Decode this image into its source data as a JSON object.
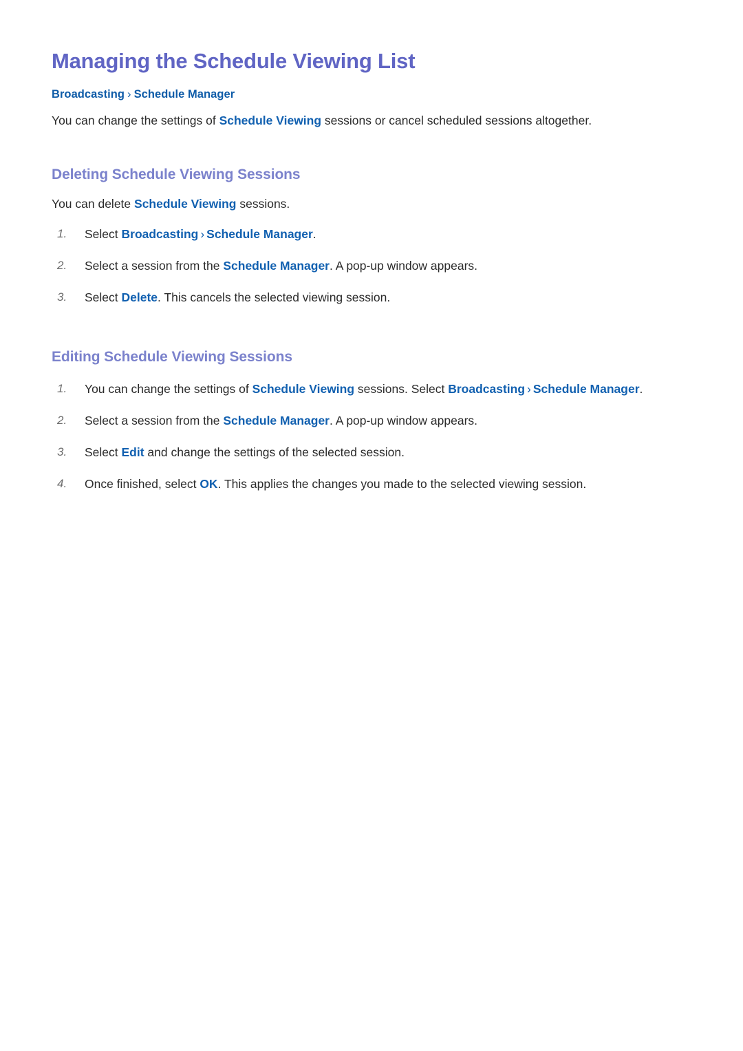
{
  "page": {
    "title": "Managing the Schedule Viewing List",
    "breadcrumb": {
      "first": "Broadcasting",
      "separator": "›",
      "second": "Schedule Manager"
    },
    "intro": {
      "before": "You can change the settings of ",
      "keyword": "Schedule Viewing",
      "after": " sessions or cancel scheduled sessions altogether."
    }
  },
  "sections": [
    {
      "heading": "Deleting Schedule Viewing Sessions",
      "lead": {
        "before": "You can delete ",
        "keyword": "Schedule Viewing",
        "after": " sessions."
      },
      "steps": [
        {
          "num": "1.",
          "p1": "Select ",
          "k1": "Broadcasting",
          "sep": "›",
          "k2": "Schedule Manager",
          "p2": "."
        },
        {
          "num": "2.",
          "p1": "Select a session from the ",
          "k1": "Schedule Manager",
          "p2": ". A pop-up window appears."
        },
        {
          "num": "3.",
          "p1": "Select ",
          "k1": "Delete",
          "p2": ". This cancels the selected viewing session."
        }
      ]
    },
    {
      "heading": "Editing Schedule Viewing Sessions",
      "steps": [
        {
          "num": "1.",
          "p1": "You can change the settings of ",
          "k1": "Schedule Viewing",
          "p2": " sessions. Select ",
          "k2": "Broadcasting",
          "sep": "›",
          "k3": "Schedule Manager",
          "p3": "."
        },
        {
          "num": "2.",
          "p1": "Select a session from the ",
          "k1": "Schedule Manager",
          "p2": ". A pop-up window appears."
        },
        {
          "num": "3.",
          "p1": "Select ",
          "k1": "Edit",
          "p2": " and change the settings of the selected session."
        },
        {
          "num": "4.",
          "p1": "Once finished, select ",
          "k1": "OK",
          "p2": ". This applies the changes you made to the selected viewing session."
        }
      ]
    }
  ],
  "colors": {
    "title": "#6065c4",
    "section_heading": "#7b82cc",
    "keyword_blue": "#1160b0",
    "breadcrumb_blue": "#0f5ca8",
    "body_text": "#2b2b2b",
    "list_number": "#6d6d6d",
    "background": "#ffffff"
  }
}
